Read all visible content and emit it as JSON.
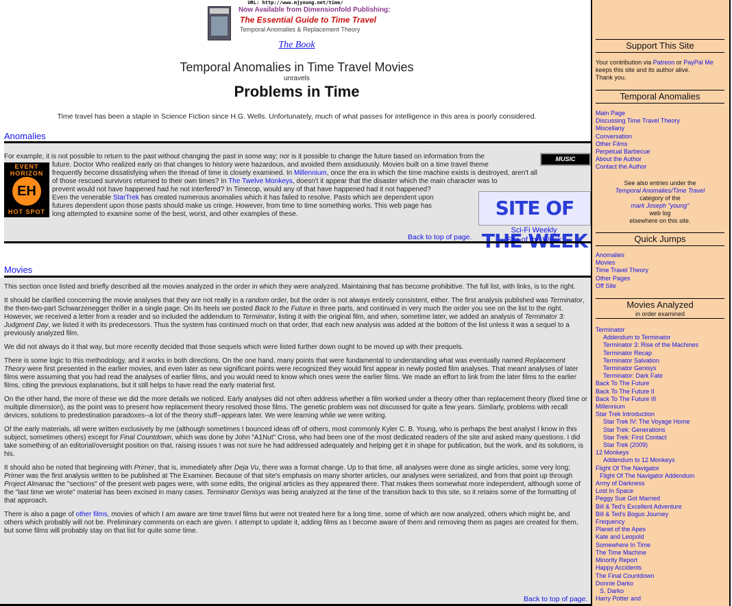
{
  "url_line": "URL: http://www.mjyoung.net/time/",
  "promo": {
    "line1": "Now Available from Dimensionfold Publishing:",
    "book_title": "The Essential Guide to Time Travel",
    "subtitle": "Temporal Anomalies & Replacement Theory",
    "link": "The Book"
  },
  "header": {
    "site_title": "Temporal Anomalies in Time Travel Movies",
    "unravels": "unravels",
    "title": "Problems in Time",
    "intro": "Time travel has been a staple in Science Fiction since H.G. Wells.  Unfortunately, much of what passes for intelligence in this area is poorly considered."
  },
  "anomalies": {
    "heading": "Anomalies",
    "logo_top": "EVENT HORIZON",
    "logo_letters": "EH",
    "logo_bottom": "HOT SPOT",
    "music_label": "MUSIC",
    "sotw_label": "SITE OF THE WEEK",
    "scifi_line1": "Sci-Fi Weekly",
    "scifi_line2": "Site of the Week",
    "p1_a": "For example, it is not possible to return to the past without changing the past in some way; nor is it possible to change the future based on information from the",
    "p1_b": "future.  Doctor Who realized early on that changes to history were hazardous, and avoided them assiduously. Movies built on a time travel theme",
    "p1_c": "frequently become dissatisfying when the thread of time is closely examined.  In",
    "p1_millennium": "Millennium",
    "p1_d": ", once the era in which the time machine exists is destroyed, aren't all",
    "p1_e": "of those rescued survivors returned to their own times?  In",
    "p1_monkeys": "The Twelve Monkeys",
    "p1_f": ", doesn't it appear that the disaster which the main character was to",
    "p1_g": "prevent would not have happened had he not interfered?  In Timecop, would any of that have happened had it not happened?",
    "p1_h": "Even the venerable",
    "p1_startrek": "StarTrek",
    "p1_i": "has created numerous anomalies which it has failed to resolve.  Pasts which are dependent upon",
    "p1_j": "futures dependent upon those pasts should make us cringe.  However, from time to time something works.  This web page has",
    "p1_k": "long attempted to examine some of the best, worst, and other examples of these.",
    "back_to_top": "Back to top of page."
  },
  "movies": {
    "heading": "Movies",
    "p1": "This section once listed and briefly described all the movies analyzed in the order in which they were analyzed.  Maintaining that has become prohibitive.  The full list, with links, is to the right.",
    "p2_a": "It should be clarified concerning the movie analyses that they are not really in a ",
    "p2_random": "random",
    "p2_b": " order, but the order is not always entirely consistent, either.  The first analysis published was ",
    "p2_terminator": "Terminator",
    "p2_c": ", the then-two-part Schwarzenegger thriller in a single page.  On its heels we posted ",
    "p2_bttf": "Back to the Future",
    "p2_d": " in three parts, and continued in very much the order you see on the list to the right.  However, we received a letter from a reader and so included the addendum to ",
    "p2_terminator2": "Terminator",
    "p2_e": ", listing it with the original film, and when, sometime later, we added an analysis of ",
    "p2_t3": "Terminator 3:  Judgment Day",
    "p2_f": ", we listed it with its predecessors.  Thus the system has continued much on that order, that each new analysis was added at the bottom of the list unless it was a sequel to a previously analyzed film.",
    "p3": "We did not always do it that way, but more recently decided that those sequels which were listed further down ought to be moved up with their prequels.",
    "p4_a": "There is some logic to this methodology, and it works in both directions.  On the one hand, many points that were fundamental to understanding what was eventually named ",
    "p4_rt": "Replacement Theory",
    "p4_b": " were first presented in the earlier movies, and even later as new significant points were recognized they would first appear in newly posted film analyses.  That meant analyses of later films were assuming that you had read the analyses of earlier films, and you would need to know which ones were the earlier films.  We made an effort to link from the later films to the earlier films, citing the previous explanations, but it still helps to have read the early material first.",
    "p5": "On the other hand, the more of these we did the more details we noticed.  Early analyses did not often address whether a film worked under a theory other than replacement theory (fixed time or multiple dimension), as the point was to present how replacement theory resolved those films.  The genetic problem was not discussed for quite a few years.  Similarly, problems with recall devices, solutions to predestination paradoxes--a lot of the theory stuff--appears later.  We were learning while we were writing.",
    "p6_a": "Of the early materials, all were written exclusively by me (although sometimes I bounced ideas off of others, most commonly Kyler C. B. Young, who is perhaps the best analyst I know in this subject, sometimes others) except for ",
    "p6_fc": "Final Countdown",
    "p6_b": ", which was done by John \"A1Nut\" Cross, who had been one of the most dedicated readers of the site and asked many questions.  I did take something of an editorial/oversight position on that, raising issues I was not sure he had addressed adequately and helping get it in shape for publication, but the work, and its solutions, is his.",
    "p7_a": "It should also be noted that beginning with ",
    "p7_primer": "Primer",
    "p7_b": ", that is, immediately after ",
    "p7_dejavu": "Deja Vu",
    "p7_c": ", there was a format change.  Up to that time, all analyses were done as single articles, some very long; ",
    "p7_primer2": "Primer",
    "p7_d": " was the first analysis written to be published at The Examiner.  Because of that site's emphasis on many shorter articles, our analyses were serialized, and from that point up through ",
    "p7_pa": "Project Almanac",
    "p7_e": " the \"sections\" of the present web pages were, with some edits, the original articles as they appeared there.  That makes them somewhat more independent, although some of the \"last time we wrote\" material has been excised in many cases.  ",
    "p7_tg": "Terminator Genisys",
    "p7_f": " was being analyzed at the time of the transition back to this site, so it retains some of the formatting of that approach.",
    "p8_a": "There is also a page of ",
    "p8_link": "other films",
    "p8_b": ", movies of which I am aware are time travel films but were not treated here for a long time, some of which are now analyzed, others which might be, and others which probably will not be.  Preliminary comments on each are given.  I attempt to update it, adding films as I become aware of them and removing them as pages are created for them, but some films will probably stay on that list for quite some time.",
    "back_to_top": "Back to top of page."
  },
  "sidebar": {
    "support_head": "Support This Site",
    "support_a": "Your contribution via ",
    "support_patreon": "Patreon",
    "support_or": " or ",
    "support_paypal": "PayPal Me",
    "support_b": "keeps this site and its author alive.",
    "support_c": "Thank you.",
    "anomalies_head": "Temporal Anomalies",
    "anomalies_links": [
      "Main Page",
      "Discussing Time Travel Theory",
      "Miscellany",
      "Conversation",
      "Other Films",
      "Perpetual Barbecue",
      "About the Author",
      "Contact the Author"
    ],
    "see_also_1": "See also entries under the",
    "see_also_2": "Temporal Anomalies/Time Travel",
    "see_also_3": "category of the",
    "see_also_4": "mark Joseph \"young\"",
    "see_also_5": "web log",
    "see_also_6": "elsewhere on this site.",
    "quick_head": "Quick Jumps",
    "quick_links": [
      "Anomalies",
      "Movies",
      "Time Travel Theory",
      "Other Pages",
      "Off Site"
    ],
    "movies_head": "Movies Analyzed",
    "movies_sub": "in order examined",
    "movies": [
      {
        "t": "Terminator",
        "i": 0
      },
      {
        "t": "Addendum to Terminator",
        "i": 1
      },
      {
        "t": "Terminator 3:  Rise of the Machines",
        "i": 1
      },
      {
        "t": "Terminator Recap",
        "i": 1
      },
      {
        "t": "Terminator Salvation",
        "i": 1
      },
      {
        "t": "Terminator Genisys",
        "i": 1
      },
      {
        "t": "Terminator:  Dark Fate",
        "i": 1
      },
      {
        "t": "Back To The Future",
        "i": 0
      },
      {
        "t": "Back To The Future II",
        "i": 0
      },
      {
        "t": "Back To The Future III",
        "i": 0
      },
      {
        "t": "Millennium",
        "i": 0
      },
      {
        "t": "Star Trek Introduction",
        "i": 0
      },
      {
        "t": "Star Trek IV: The Voyage Home",
        "i": 1
      },
      {
        "t": "Star Trek: Generations",
        "i": 1
      },
      {
        "t": "Star Trek: First Contact",
        "i": 1
      },
      {
        "t": "Star Trek (2009)",
        "i": 1
      },
      {
        "t": "12 Monkeys",
        "i": 0
      },
      {
        "t": "Addendum to 12 Monkeys",
        "i": 1
      },
      {
        "t": "Flight Of The Navigator",
        "i": 0
      },
      {
        "t": "Flight Of The Navigator Addendum",
        "i": 2
      },
      {
        "t": "Army of Darkness",
        "i": 0
      },
      {
        "t": "Lost In Space",
        "i": 0
      },
      {
        "t": "Peggy Sue Got Married",
        "i": 0
      },
      {
        "t": "Bill & Ted's Excellent Adventure",
        "i": 0
      },
      {
        "t": "Bill & Ted's Bogus Journey",
        "i": 0
      },
      {
        "t": "Frequency",
        "i": 0
      },
      {
        "t": "Planet of the Apes",
        "i": 0
      },
      {
        "t": "Kate and Leopold",
        "i": 0
      },
      {
        "t": "Somewhere In Time",
        "i": 0
      },
      {
        "t": "The Time Machine",
        "i": 0
      },
      {
        "t": "Minority Report",
        "i": 0
      },
      {
        "t": "Happy Accidents",
        "i": 0
      },
      {
        "t": "The Final Countdown",
        "i": 0
      },
      {
        "t": "Donnie Darko",
        "i": 0
      },
      {
        "t": "S. Darko",
        "i": 2
      },
      {
        "t": "Harry Potter and",
        "i": 0
      }
    ]
  },
  "colors": {
    "sidebar_bg": "#f9d2a8",
    "link": "#1414e6",
    "section_bg": "#e4e4e4"
  }
}
